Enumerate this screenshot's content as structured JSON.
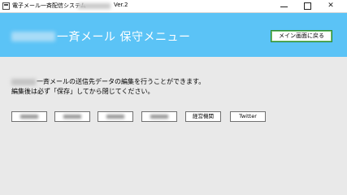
{
  "window": {
    "title": "電子メール一斉配信システム",
    "version": "Ver.2",
    "controls": {
      "minimize": "",
      "maximize": "",
      "close": "✕"
    }
  },
  "header": {
    "title": "一斉メール 保守メニュー",
    "return_button": "メイン画面に戻る",
    "color": "#5bc3f6"
  },
  "description": {
    "line1": "一斉メールの送信先データの編集を行うことができます。",
    "line2": "編集後は必ず「保存」してから閉じてください。"
  },
  "buttons": [
    {
      "label": ""
    },
    {
      "label": ""
    },
    {
      "label": ""
    },
    {
      "label": ""
    },
    {
      "label": "経営機関"
    },
    {
      "label": "Twitter"
    }
  ]
}
